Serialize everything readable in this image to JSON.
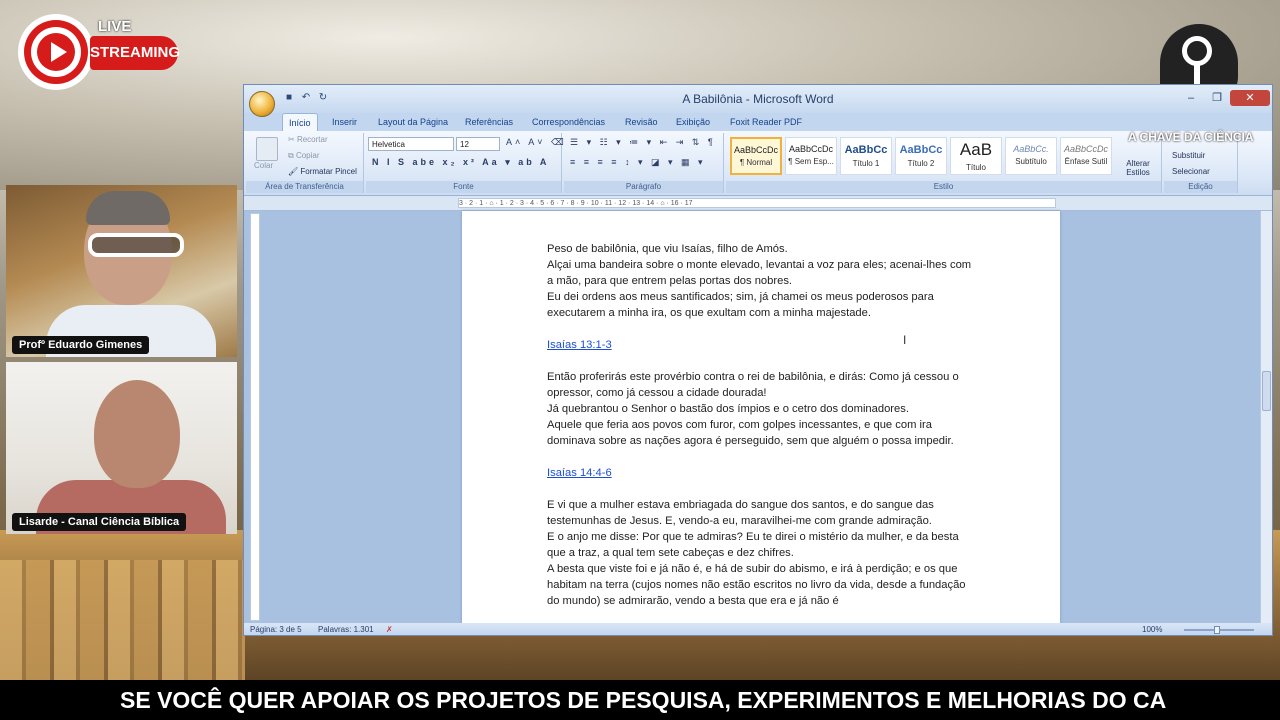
{
  "overlay": {
    "live_label": "LIVE",
    "streaming_label": "STREAMING",
    "channel_logo_text": "A CHAVE DA CIÊNCIA",
    "ticker": "SE VOCÊ QUER APOIAR OS PROJETOS DE PESQUISA, EXPERIMENTOS E MELHORIAS DO CA",
    "participants": [
      {
        "name": "Profº Eduardo Gimenes"
      },
      {
        "name": "Lisarde - Canal Ciência Bíblica"
      }
    ]
  },
  "word": {
    "title": "A Babilônia - Microsoft Word",
    "tabs": [
      "Início",
      "Inserir",
      "Layout da Página",
      "Referências",
      "Correspondências",
      "Revisão",
      "Exibição",
      "Foxit Reader PDF"
    ],
    "active_tab": "Início",
    "ribbon": {
      "clipboard": {
        "label": "Área de Transferência",
        "paste": "Colar",
        "cut": "Recortar",
        "copy": "Copiar",
        "format_painter": "Formatar Pincel"
      },
      "font": {
        "label": "Fonte",
        "family": "Helvetica",
        "size": "12"
      },
      "paragraph": {
        "label": "Parágrafo"
      },
      "styles": {
        "label": "Estilo",
        "change_styles": "Alterar Estilos",
        "items": [
          {
            "preview": "AaBbCcDc",
            "name": "¶ Normal"
          },
          {
            "preview": "AaBbCcDc",
            "name": "¶ Sem Esp..."
          },
          {
            "preview": "AaBbCc",
            "name": "Título 1"
          },
          {
            "preview": "AaBbCc",
            "name": "Título 2"
          },
          {
            "preview": "AaB",
            "name": "Título"
          },
          {
            "preview": "AaBbCc.",
            "name": "Subtítulo"
          },
          {
            "preview": "AaBbCcDc",
            "name": "Ênfase Sutil"
          }
        ]
      },
      "editing": {
        "label": "Edição",
        "replace": "Substituir",
        "select": "Selecionar"
      }
    },
    "ruler_text": "3 · 2 · 1 · ⌂ · 1 · 2 · 3 · 4 · 5 · 6 · 7 · 8 · 9 · 10 · 11 · 12 · 13 · 14 · ⌂ · 16 · 17",
    "document": [
      {
        "type": "p",
        "text": "Peso de babilônia, que viu Isaías,  filho de Amós."
      },
      {
        "type": "p",
        "text": "Alçai uma bandeira sobre o monte elevado, levantai a voz para eles; acenai-lhes com a mão, para que entrem pelas portas dos nobres."
      },
      {
        "type": "p",
        "text": "Eu dei ordens aos meus santificados; sim, já chamei os meus poderosos para executarem a minha ira, os que exultam com a minha majestade."
      },
      {
        "type": "gap"
      },
      {
        "type": "link",
        "text": "Isaías 13:1-3"
      },
      {
        "type": "gap"
      },
      {
        "type": "p",
        "text": "Então proferirás este provérbio contra o rei de babilônia, e dirás: Como já cessou o opressor, como já cessou a cidade dourada!"
      },
      {
        "type": "p",
        "text": "Já quebrantou o Senhor o bastão dos ímpios e o cetro dos dominadores."
      },
      {
        "type": "p",
        "text": "Aquele que feria aos povos com furor, com golpes incessantes, e que com ira dominava sobre as nações agora é perseguido, sem que alguém o possa impedir."
      },
      {
        "type": "gap"
      },
      {
        "type": "link",
        "text": "Isaías 14:4-6"
      },
      {
        "type": "gap"
      },
      {
        "type": "p",
        "text": "E vi que a mulher estava embriagada do sangue dos santos, e do sangue das testemunhas de Jesus. E, vendo-a eu, maravilhei-me com grande admiração."
      },
      {
        "type": "p",
        "text": "E o anjo me disse: Por que te admiras? Eu te direi o mistério da mulher, e da besta que a traz, a qual tem sete cabeças e dez chifres."
      },
      {
        "type": "p",
        "text": "A besta que viste foi e já não é, e há de subir do abismo, e irá à perdição; e os que habitam na terra (cujos nomes não estão escritos no livro da vida, desde a fundação do mundo) se admirarão, vendo a besta que era e já não é"
      }
    ],
    "status": {
      "page": "Página: 3 de 5",
      "words": "Palavras: 1.301",
      "zoom": "100%"
    }
  }
}
